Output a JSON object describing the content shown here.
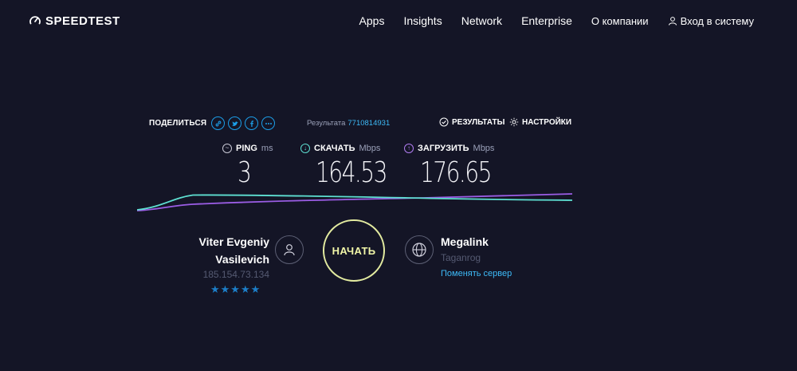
{
  "header": {
    "logo_text": "SPEEDTEST",
    "nav": [
      "Apps",
      "Insights",
      "Network",
      "Enterprise"
    ],
    "about": "О компании",
    "login": "Вход в систему"
  },
  "toolbar": {
    "share_label": "ПОДЕЛИТЬСЯ",
    "result_label": "Результата",
    "result_id": "7710814931",
    "results_label": "РЕЗУЛЬТАТЫ",
    "settings_label": "НАСТРОЙКИ"
  },
  "metrics": {
    "ping": {
      "label": "PING",
      "unit": "ms",
      "value": "3"
    },
    "download": {
      "label": "СКАЧАТЬ",
      "unit": "Mbps",
      "value": "164.53"
    },
    "upload": {
      "label": "ЗАГРУЗИТЬ",
      "unit": "Mbps",
      "value": "176.65"
    }
  },
  "client": {
    "name_line1": "Viter Evgeniy",
    "name_line2": "Vasilevich",
    "ip": "185.154.73.134",
    "stars": "★★★★★",
    "rating": 5
  },
  "go_button": "НАЧАТЬ",
  "server": {
    "name": "Megalink",
    "location": "Taganrog",
    "change_label": "Поменять сервер"
  },
  "colors": {
    "background": "#141526",
    "accent_blue": "#1c9ee8",
    "download_line": "#5ee0d2",
    "upload_line": "#9b5de5",
    "go_ring": "#e3eba0"
  }
}
